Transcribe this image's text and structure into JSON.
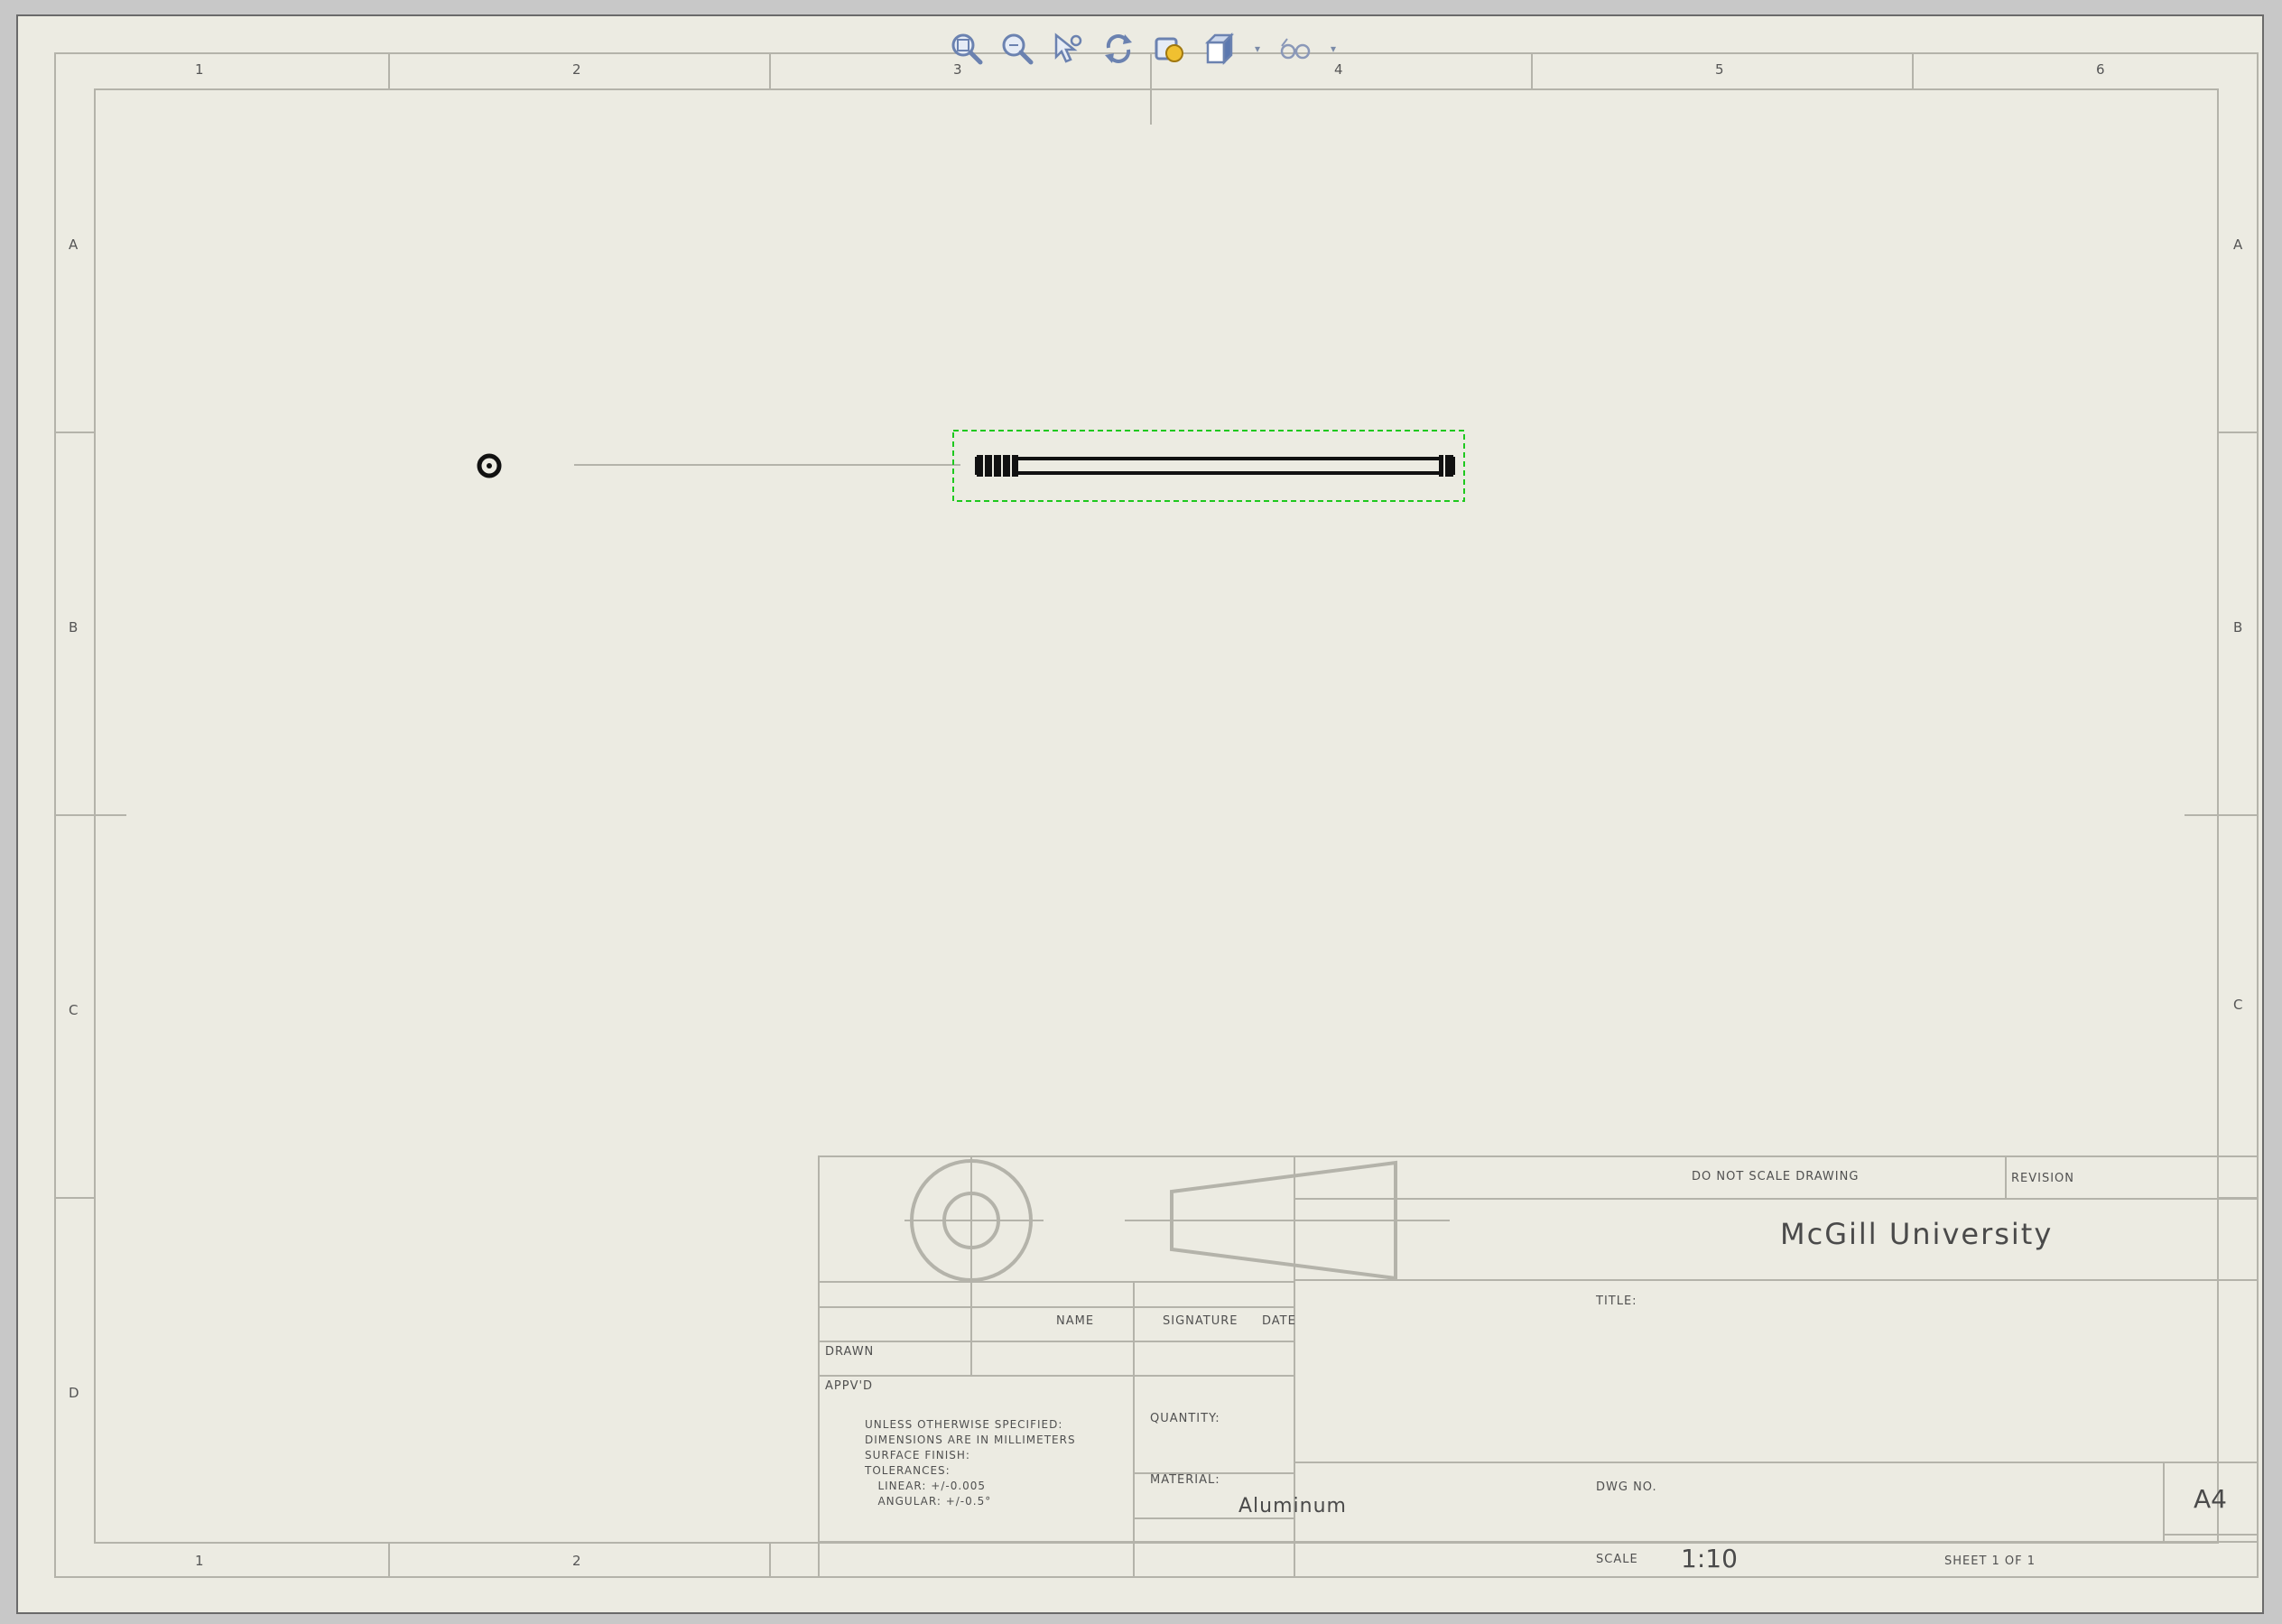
{
  "toolbar": {
    "tools": [
      "zoom-to-fit-icon",
      "zoom-area-icon",
      "select-tool-icon",
      "rotate-icon",
      "appearance-icon",
      "view-orientation-cube-icon",
      "display-hidden-icon"
    ]
  },
  "zones": {
    "columns": [
      "1",
      "2",
      "3",
      "4",
      "5",
      "6"
    ],
    "rows": [
      "A",
      "B",
      "C",
      "D"
    ]
  },
  "title_block": {
    "do_not_scale": "DO NOT SCALE DRAWING",
    "revision_label": "REVISION",
    "company": "McGill University",
    "title_label": "TITLE:",
    "name_label": "NAME",
    "signature_label": "SIGNATURE",
    "date_label": "DATE",
    "drawn_label": "DRAWN",
    "approved_label": "APPV'D",
    "notes": [
      "UNLESS OTHERWISE SPECIFIED:",
      "DIMENSIONS ARE IN MILLIMETERS",
      "SURFACE FINISH:",
      "TOLERANCES:",
      "   LINEAR: +/-0.005",
      "   ANGULAR: +/-0.5°"
    ],
    "quantity_label": "QUANTITY:",
    "material_label": "MATERIAL:",
    "material": "Aluminum",
    "dwg_no_label": "DWG NO.",
    "size": "A4",
    "scale_label": "SCALE",
    "scale": "1:10",
    "sheet_label": "SHEET 1 OF 1"
  }
}
